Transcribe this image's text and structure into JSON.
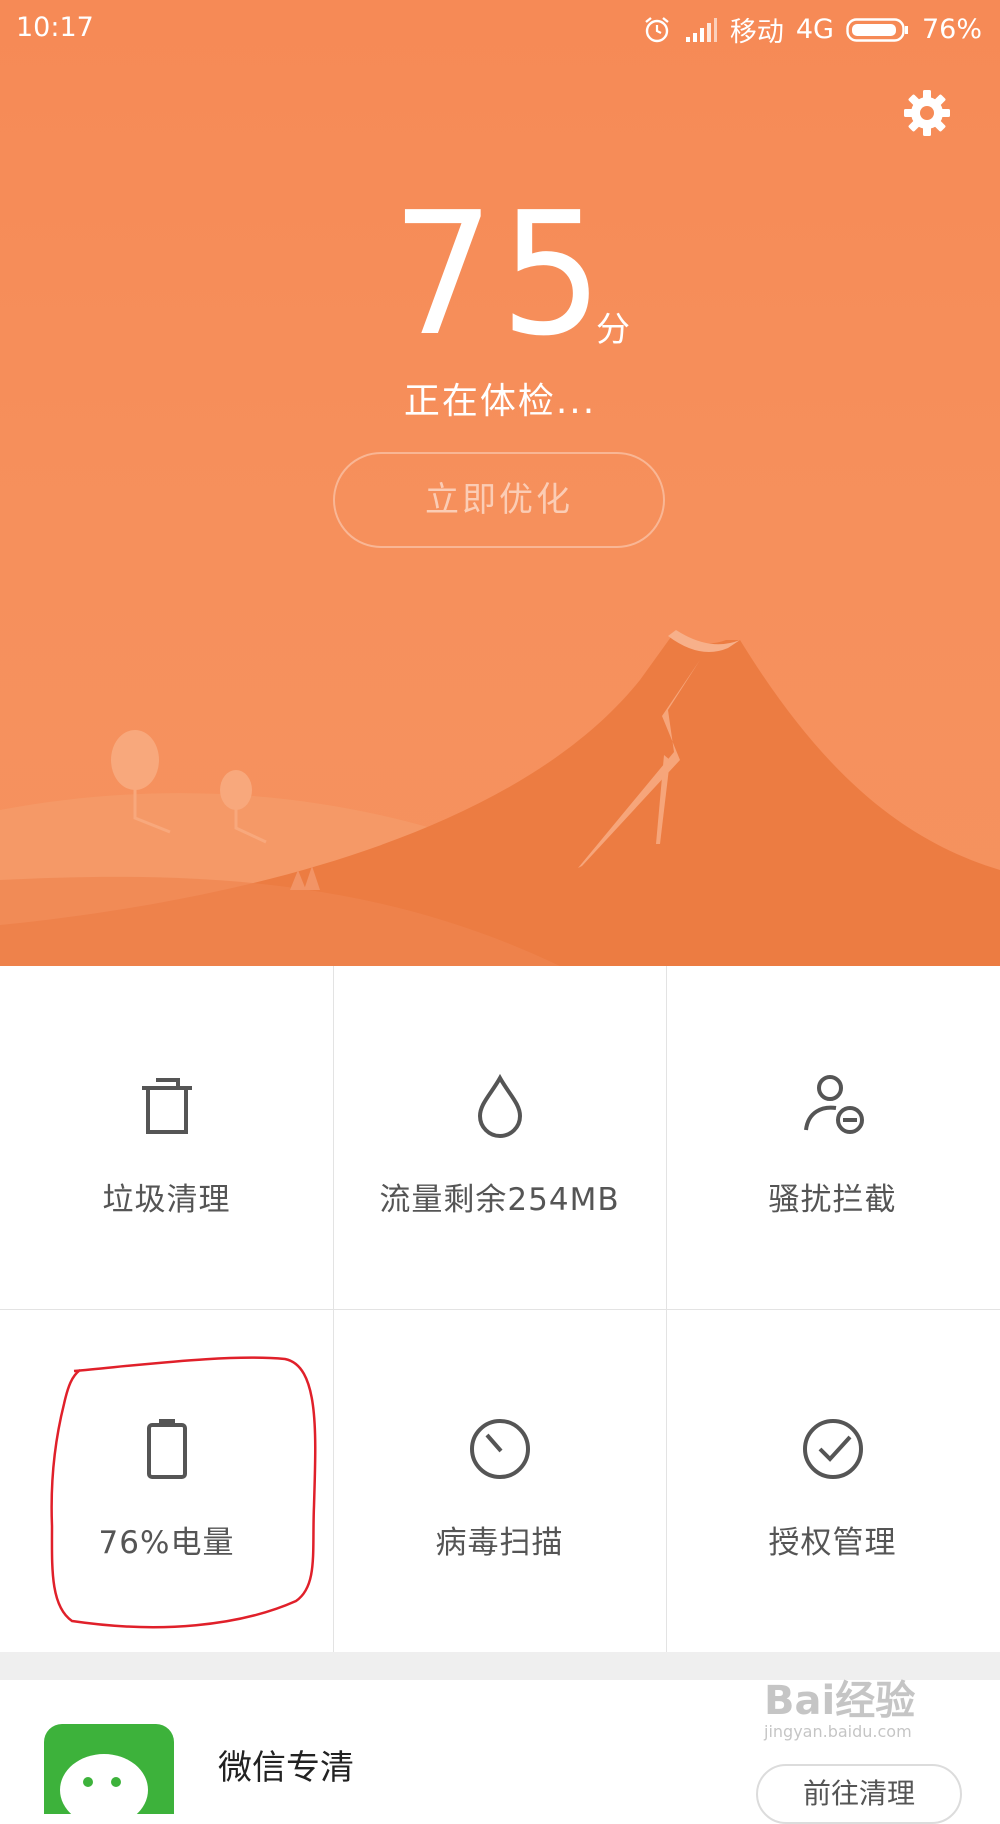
{
  "status_bar": {
    "time": "10:17",
    "carrier": "移动",
    "network": "4G",
    "battery": "76%"
  },
  "header": {
    "score": "75",
    "score_unit": "分",
    "status": "正在体检...",
    "optimize_label": "立即优化"
  },
  "tools": [
    {
      "label": "垃圾清理",
      "icon": "trash-icon"
    },
    {
      "label": "流量剩余254MB",
      "icon": "water-drop-icon"
    },
    {
      "label": "骚扰拦截",
      "icon": "user-block-icon"
    },
    {
      "label": "76%电量",
      "icon": "battery-icon"
    },
    {
      "label": "病毒扫描",
      "icon": "scan-dial-icon"
    },
    {
      "label": "授权管理",
      "icon": "check-circle-icon"
    }
  ],
  "card": {
    "title": "微信专清",
    "button_label": "前往清理"
  },
  "watermark": {
    "brand": "Bai经验",
    "url": "jingyan.baidu.com"
  },
  "colors": {
    "header_orange": "#f68a56",
    "volcano": "#eb7a40",
    "annotation_red": "#e0202a",
    "wechat_green": "#3db23b"
  }
}
